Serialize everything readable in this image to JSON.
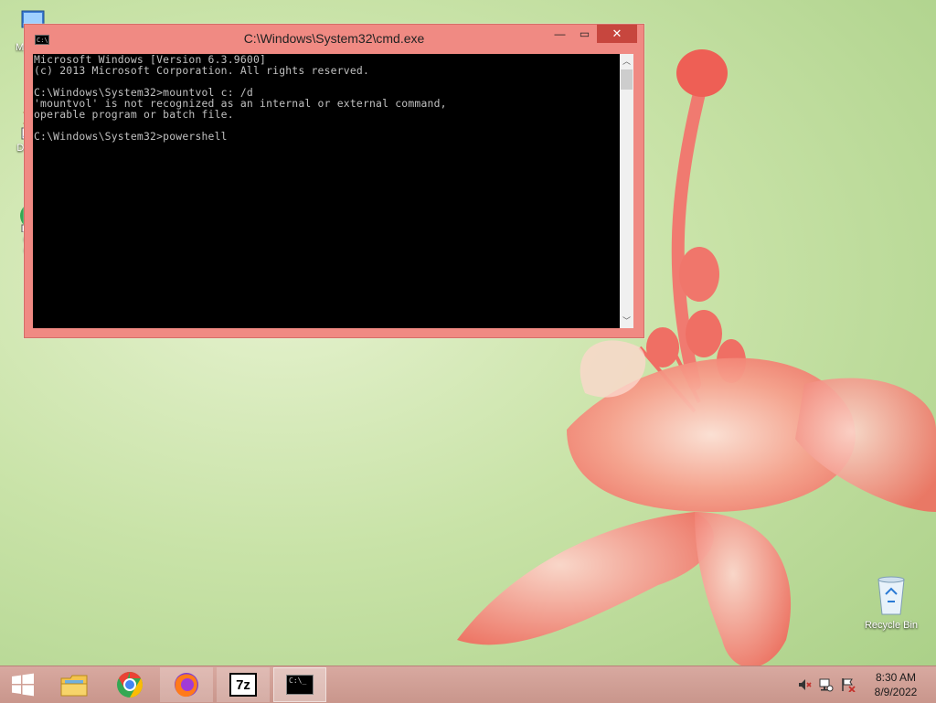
{
  "desktop": {
    "icons": [
      {
        "label": "My C"
      },
      {
        "label": "Data"
      },
      {
        "label": "G\nC"
      },
      {
        "label": "Recycle Bin"
      }
    ]
  },
  "cmd_window": {
    "title": "C:\\Windows\\System32\\cmd.exe",
    "console_lines": "Microsoft Windows [Version 6.3.9600]\n(c) 2013 Microsoft Corporation. All rights reserved.\n\nC:\\Windows\\System32>mountvol c: /d\n'mountvol' is not recognized as an internal or external command,\noperable program or batch file.\n\nC:\\Windows\\System32>powershell",
    "min_glyph": "—",
    "max_glyph": "▭",
    "close_glyph": "✕"
  },
  "taskbar": {
    "sevenzip_label": "7z",
    "clock_time": "8:30 AM",
    "clock_date": "8/9/2022"
  },
  "colors": {
    "titlebar": "#f08a83",
    "close_button": "#c7463e",
    "console_bg": "#000000",
    "console_text": "#c0c0c0"
  }
}
